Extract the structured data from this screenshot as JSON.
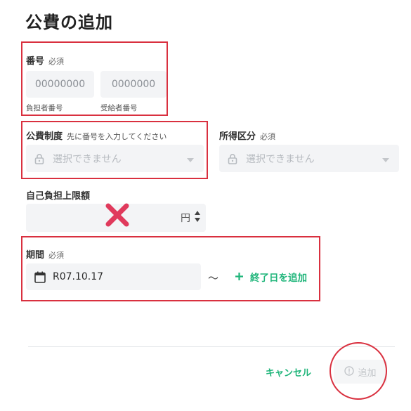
{
  "dialog": {
    "title": "公費の追加"
  },
  "number_section": {
    "label": "番号",
    "required": "必須",
    "payer_placeholder": "00000000",
    "payer_sublabel": "負担者番号",
    "recipient_placeholder": "0000000",
    "recipient_sublabel": "受給者番号"
  },
  "public_system": {
    "label": "公費制度",
    "hint": "先に番号を入力してください",
    "value": "選択できません"
  },
  "income_category": {
    "label": "所得区分",
    "required": "必須",
    "value": "選択できません"
  },
  "self_pay_limit": {
    "label": "自己負担上限額",
    "unit": "円"
  },
  "period": {
    "label": "期間",
    "required": "必須",
    "start_value": "R07.10.17",
    "separator": "〜",
    "add_end_label": "終了日を追加"
  },
  "footer": {
    "cancel_label": "キャンセル",
    "add_label": "追加"
  },
  "colors": {
    "accent": "#1fb57a",
    "annotation": "#d9303f",
    "field_bg": "#f3f4f6"
  }
}
